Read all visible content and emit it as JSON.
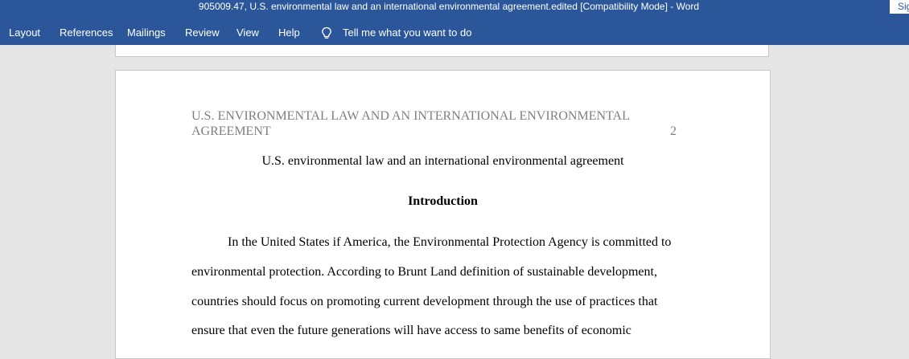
{
  "window": {
    "title": "905009.47, U.S. environmental law and an international environmental agreement.edited [Compatibility Mode]  -  Word",
    "signin_label": "Sign in"
  },
  "menu": {
    "items": [
      "Layout",
      "References",
      "Mailings",
      "Review",
      "View",
      "Help"
    ],
    "tell_me": "Tell me what you want to do",
    "tell_me_icon": "lightbulb-icon"
  },
  "document": {
    "header": "U.S. ENVIRONMENTAL LAW AND AN INTERNATIONAL ENVIRONMENTAL AGREEMENT",
    "page_number": "2",
    "title": "U.S. environmental law and an international environmental agreement",
    "heading": "Introduction",
    "lines": [
      "In the United States if America, the Environmental Protection Agency is committed to",
      "environmental protection. According to Brunt Land definition of sustainable development,",
      "countries should focus on promoting current development through the use of practices that",
      "ensure that even the future generations will have access to same benefits of economic"
    ]
  }
}
